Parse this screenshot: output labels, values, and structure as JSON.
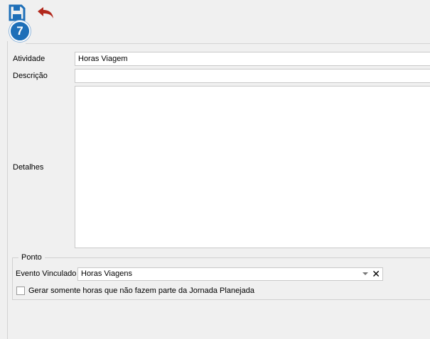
{
  "toolbar": {
    "save_icon": "floppy-disk-icon",
    "undo_icon": "undo-arrow-icon",
    "step_badge": "7",
    "accent_color": "#1e6fb8",
    "undo_color": "#b2281c"
  },
  "form": {
    "atividade_label": "Atividade",
    "atividade_value": "Horas Viagem",
    "descricao_label": "Descrição",
    "descricao_value": "",
    "detalhes_label": "Detalhes",
    "detalhes_value": ""
  },
  "ponto": {
    "legend": "Ponto",
    "evento_label": "Evento Vinculado",
    "evento_value": "Horas Viagens",
    "clear_glyph": "✕",
    "gerar_label": "Gerar somente horas que não fazem parte da Jornada Planejada",
    "gerar_checked": false
  }
}
